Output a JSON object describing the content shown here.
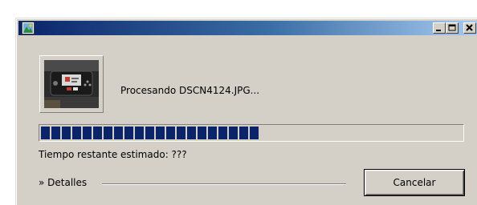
{
  "window": {
    "title": "",
    "icon": "image-app-icon",
    "controls": [
      "minimize-icon",
      "maximize-icon",
      "close-icon"
    ]
  },
  "thumbnail": {
    "icon": "photo-thumbnail"
  },
  "status": {
    "processing_text": "Procesando DSCN4124.JPG..."
  },
  "progress": {
    "fraction": 0.51,
    "color": "#0a246a"
  },
  "time": {
    "remaining_text": "Tiempo restante estimado: ???"
  },
  "details": {
    "label": "» Detalles"
  },
  "buttons": {
    "cancel_label": "Cancelar"
  },
  "colors": {
    "dialog_bg": "#d4d0c8",
    "titlebar_start": "#0a246a",
    "titlebar_end": "#a6caf0"
  }
}
